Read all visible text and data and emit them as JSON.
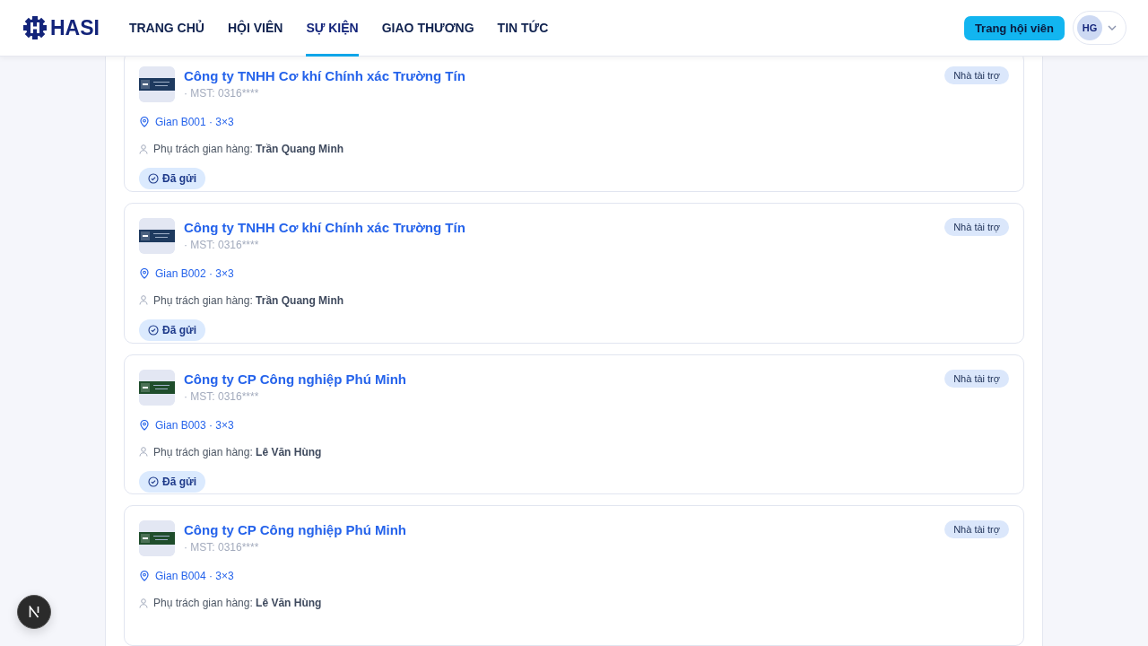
{
  "header": {
    "logo_text": "HASI",
    "nav": [
      {
        "label": "TRANG CHỦ",
        "selected": false
      },
      {
        "label": "HỘI VIÊN",
        "selected": false
      },
      {
        "label": "SỰ KIỆN",
        "selected": true
      },
      {
        "label": "GIAO THƯƠNG",
        "selected": false
      },
      {
        "label": "TIN TỨC",
        "selected": false
      }
    ],
    "member_button": "Trang hội viên",
    "avatar": "HG"
  },
  "booths": [
    {
      "color": "#1e3a5f",
      "company": "Công ty TNHH Cơ khí Chính xác Trường Tín",
      "tax_id": "· MST: 0316****",
      "badge": "Nhà tài trợ",
      "location": "Gian B001 · 3×3",
      "manager_label": "Phụ trách gian hàng:",
      "manager": "Trần Quang Minh",
      "status": "Đã gửi"
    },
    {
      "color": "#1e3a5f",
      "company": "Công ty TNHH Cơ khí Chính xác Trường Tín",
      "tax_id": "· MST: 0316****",
      "badge": "Nhà tài trợ",
      "location": "Gian B002 · 3×3",
      "manager_label": "Phụ trách gian hàng:",
      "manager": "Trần Quang Minh",
      "status": "Đã gửi"
    },
    {
      "color": "#1f4d2b",
      "company": "Công ty CP Công nghiệp Phú Minh",
      "tax_id": "· MST: 0316****",
      "badge": "Nhà tài trợ",
      "location": "Gian B003 · 3×3",
      "manager_label": "Phụ trách gian hàng:",
      "manager": "Lê Văn Hùng",
      "status": "Đã gửi"
    },
    {
      "color": "#1f4d2b",
      "company": "Công ty CP Công nghiệp Phú Minh",
      "tax_id": "· MST: 0316****",
      "badge": "Nhà tài trợ",
      "location": "Gian B004 · 3×3",
      "manager_label": "Phụ trách gian hàng:",
      "manager": "Lê Văn Hùng"
    }
  ]
}
